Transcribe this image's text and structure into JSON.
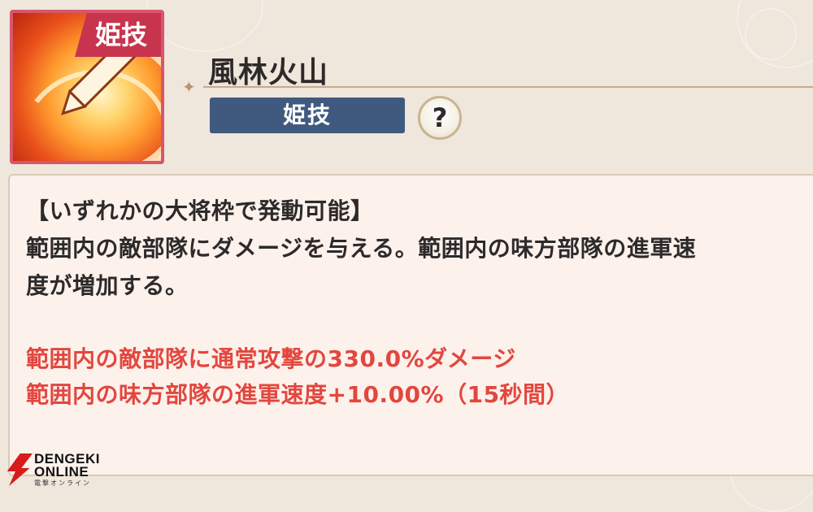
{
  "skill": {
    "icon_badge": "姫技",
    "name": "風林火山",
    "type_label": "姫技",
    "help_symbol": "?",
    "icon": "sword-slash-icon"
  },
  "description": {
    "lines": [
      "【いずれかの大将枠で発動可能】",
      "範囲内の敵部隊にダメージを与える。範囲内の味方部隊の進軍速",
      "度が増加する。"
    ]
  },
  "effects": [
    "範囲内の敵部隊に通常攻撃の330.0%ダメージ",
    "範囲内の味方部隊の進軍速度+10.00%（15秒間）"
  ],
  "watermark": {
    "line1": "DENGEKI",
    "line2": "ONLINE",
    "line3": "電撃オンライン"
  },
  "colors": {
    "badge": "#c8344e",
    "type_tag": "#3f5a7e",
    "effect_text": "#e2473e",
    "panel": "#fdf1ec"
  }
}
